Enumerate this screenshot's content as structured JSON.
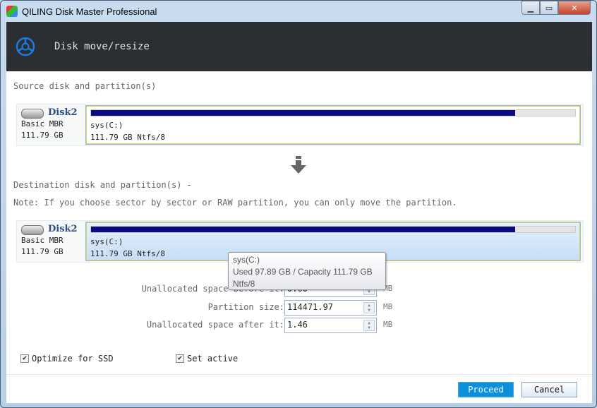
{
  "window": {
    "title": "QILING Disk Master Professional",
    "controls": [
      "minimize",
      "maximize",
      "close"
    ]
  },
  "header": {
    "title": "Disk move/resize",
    "icon": "disk-move-resize-icon"
  },
  "source": {
    "label": "Source disk and partition(s)",
    "disk": {
      "name": "Disk2",
      "type": "Basic MBR",
      "size": "111.79 GB"
    },
    "partition": {
      "name": "sys(C:)",
      "detail": "111.79 GB Ntfs/8",
      "used_fraction": 0.876
    }
  },
  "destination": {
    "label": "Destination disk and partition(s) -",
    "note": "Note: If you choose sector by sector or RAW partition, you can only move the partition.",
    "disk": {
      "name": "Disk2",
      "type": "Basic MBR",
      "size": "111.79 GB"
    },
    "partition": {
      "name": "sys(C:)",
      "detail": "111.79 GB Ntfs/8",
      "used_fraction": 0.876
    }
  },
  "tooltip": {
    "line1": "sys(C:)",
    "line2": "Used 97.89 GB / Capacity 111.79 GB",
    "line3": "Ntfs/8"
  },
  "fields": [
    {
      "label": "Unallocated space before it:",
      "value": "0.00",
      "unit": "MB"
    },
    {
      "label": "Partition size:",
      "value": "114471.97",
      "unit": "MB"
    },
    {
      "label": "Unallocated space after it:",
      "value": "1.46",
      "unit": "MB"
    }
  ],
  "options": {
    "ssd": {
      "label": "Optimize for SSD",
      "checked": true
    },
    "active": {
      "label": "Set active",
      "checked": true
    }
  },
  "buttons": {
    "proceed": "Proceed",
    "cancel": "Cancel"
  },
  "colors": {
    "header_bg": "#2b2e33",
    "bar_fill": "#0b0b80",
    "proceed": "#0d90dc"
  }
}
